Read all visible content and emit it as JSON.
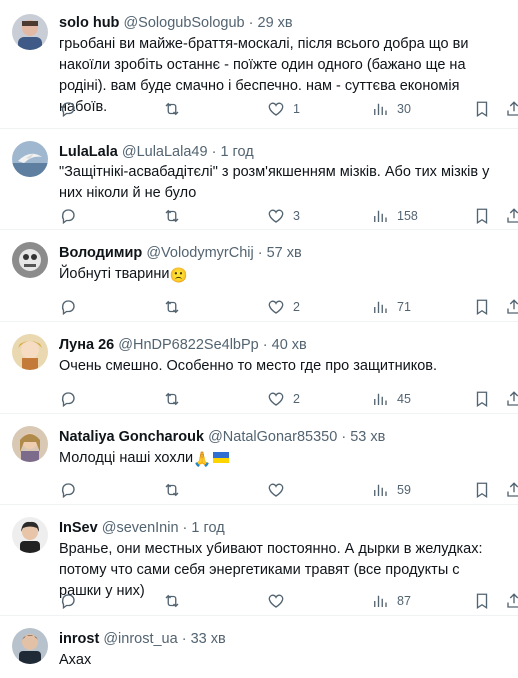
{
  "tweets": [
    {
      "name": "solo hub",
      "handle": "@SologubSologub",
      "dot": "·",
      "time": "29 хв",
      "text": "грьобані ви майже-браття-москалі, після всього добра що ви накоїли зробіть останнє - поїжте один одного (бажано ще на родіні). вам буде смачно і беспечно. нам - суттєва економія набоїв.",
      "replies": "",
      "retweets": "",
      "likes": "1",
      "views": "30"
    },
    {
      "name": "LulaLala",
      "handle": "@LulaLala49",
      "dot": "·",
      "time": "1 год",
      "text": "\"Защітнікі-асвабадітєлі\" з розм'якшенням мізків. Або тих мізків у них ніколи й не було",
      "replies": "",
      "retweets": "",
      "likes": "3",
      "views": "158"
    },
    {
      "name": "Володимир",
      "handle": "@VolodymyrChij",
      "dot": "·",
      "time": "57 хв",
      "text": "Йобнуті тварини",
      "emoji": "🙁",
      "replies": "",
      "retweets": "",
      "likes": "2",
      "views": "71"
    },
    {
      "name": "Луна 26",
      "handle": "@HnDP6822Se4lbPp",
      "dot": "·",
      "time": "40 хв",
      "text": "Очень смешно. Особенно то место где про защитников.",
      "replies": "",
      "retweets": "",
      "likes": "2",
      "views": "45"
    },
    {
      "name": "Nataliya Goncharouk",
      "handle": "@NatalGonar85350",
      "dot": "·",
      "time": "53 хв",
      "text": "Молодці наші хохли",
      "emoji": "🙏",
      "replies": "",
      "retweets": "",
      "likes": "",
      "views": "59"
    },
    {
      "name": "InSev",
      "handle": "@sevenInin",
      "dot": "·",
      "time": "1 год",
      "text": "Вранье, они местных убивают постоянно. А дырки в желудках: потому что сами себя энергетиками травят (все продукты с рашки у них)",
      "replies": "",
      "retweets": "",
      "likes": "",
      "views": "87"
    },
    {
      "name": "inrost",
      "handle": "@inrost_ua",
      "dot": "·",
      "time": "33 хв",
      "text": "Axax",
      "replies": "",
      "retweets": "",
      "likes": "",
      "views": ""
    }
  ],
  "icons": {
    "reply": "reply-icon",
    "retweet": "retweet-icon",
    "like": "like-icon",
    "views": "views-icon",
    "bookmark": "bookmark-icon",
    "share": "share-icon"
  },
  "colors": {
    "text": "#0f1419",
    "secondary": "#536471",
    "divider": "#eff3f4",
    "flag_blue": "#2e6fd1",
    "flag_yellow": "#ffd500"
  }
}
